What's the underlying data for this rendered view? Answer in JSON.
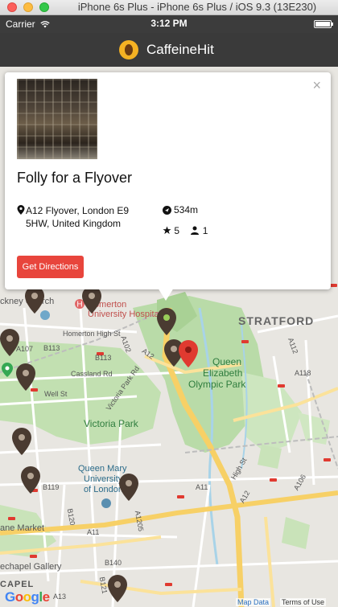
{
  "simulator": {
    "window_title": "iPhone 6s Plus - iPhone 6s Plus / iOS 9.3 (13E230)"
  },
  "status_bar": {
    "carrier": "Carrier",
    "time": "3:12 PM"
  },
  "app": {
    "title": "CaffeineHit",
    "logo_icon": "coffee-bean-icon"
  },
  "popup": {
    "close_glyph": "×",
    "venue_name": "Folly for a Flyover",
    "address": "A12 Flyover, London E9 5HW, United Kingdom",
    "distance": "534m",
    "rating": "5",
    "checkins": "1",
    "directions_button": "Get Directions"
  },
  "map": {
    "labels": {
      "stratford": "STRATFORD",
      "homerton_hospital_1": "Homerton",
      "homerton_hospital_2": "University Hospital",
      "hackney_church": "ckney Church",
      "homerton_high_st": "Homerton High St",
      "queen_elizabeth_park_1": "Queen",
      "queen_elizabeth_park_2": "Elizabeth",
      "queen_elizabeth_park_3": "Olympic Park",
      "victoria_park": "Victoria Park",
      "qmul_1": "Queen Mary",
      "qmul_2": "University",
      "qmul_3": "of London",
      "lane_market": "ane Market",
      "whitechapel_gallery": "echapel Gallery",
      "chapel": "CAPEL",
      "cassland_rd": "Cassland Rd",
      "victoria_park_rd": "Victoria Park Rd",
      "well_st": "Well St",
      "a12": "A12",
      "a11": "A11",
      "a13": "A13",
      "a102": "A102",
      "a112": "A112",
      "a118": "A118",
      "a106": "A106",
      "a107": "A107",
      "b113": "B113",
      "b119": "B119",
      "b120": "B120",
      "b140": "B140",
      "b121": "B121",
      "a1205": "A1205",
      "high_st": "High St"
    },
    "google": "Google",
    "map_data": "Map Data",
    "terms": "Terms of Use"
  },
  "colors": {
    "navbar": "#3a3a3a",
    "pin": "#4a3b31",
    "selected_pin": "#e03a30",
    "button": "#e8453c"
  }
}
